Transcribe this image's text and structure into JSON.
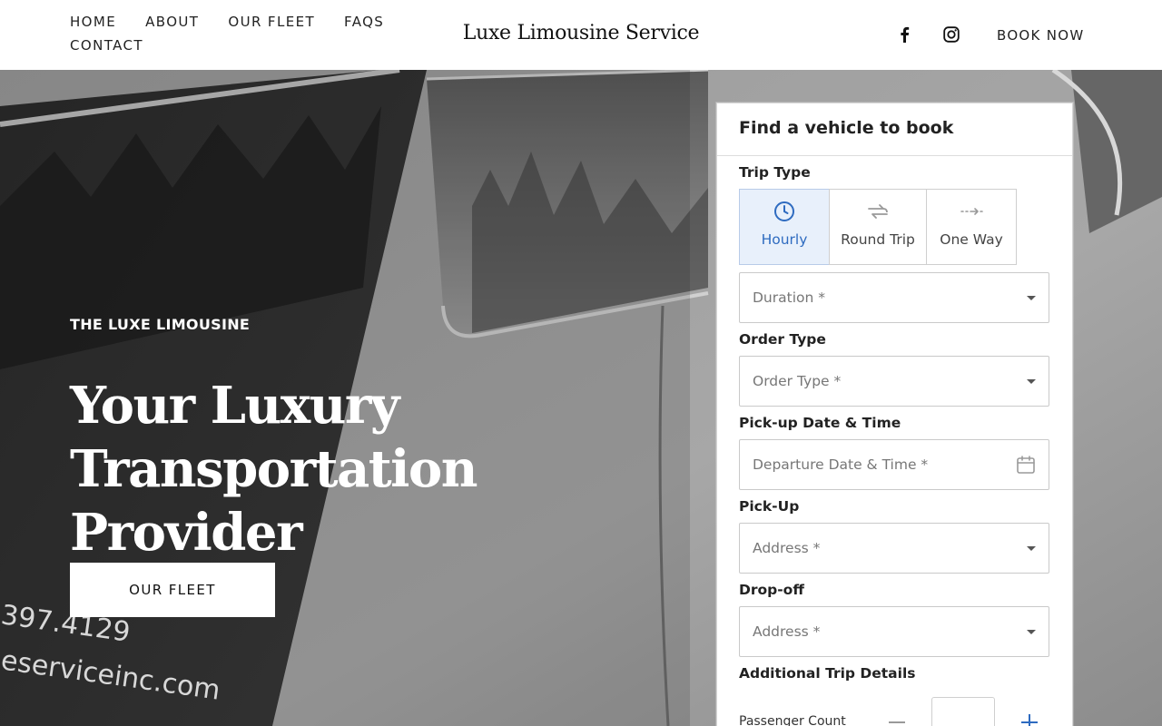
{
  "header": {
    "nav": [
      {
        "label": "HOME"
      },
      {
        "label": "ABOUT"
      },
      {
        "label": "OUR FLEET"
      },
      {
        "label": "FAQS"
      },
      {
        "label": "CONTACT"
      }
    ],
    "logo": "Luxe Limousine Service",
    "social": [
      "facebook-icon",
      "instagram-icon"
    ],
    "book_now": "BOOK NOW"
  },
  "hero": {
    "eyebrow": "THE LUXE LIMOUSINE",
    "headline_line1": "Your Luxury",
    "headline_line2": "Transportation Provider",
    "cta": "OUR FLEET",
    "background": "grayscale photo of a limousine bus side and window",
    "bg_text_1": "397.4129",
    "bg_text_2": "eserviceinc.com"
  },
  "booking": {
    "title": "Find a vehicle to book",
    "trip_type_label": "Trip Type",
    "trip_types": [
      {
        "label": "Hourly",
        "icon": "clock-icon",
        "active": true
      },
      {
        "label": "Round Trip",
        "icon": "round-trip-icon",
        "active": false
      },
      {
        "label": "One Way",
        "icon": "one-way-icon",
        "active": false
      }
    ],
    "duration_placeholder": "Duration *",
    "order_type_label": "Order Type",
    "order_type_placeholder": "Order Type *",
    "pickup_datetime_label": "Pick-up Date & Time",
    "pickup_datetime_placeholder": "Departure Date & Time *",
    "pickup_label": "Pick-Up",
    "pickup_placeholder": "Address *",
    "dropoff_label": "Drop-off",
    "dropoff_placeholder": "Address *",
    "additional_label": "Additional Trip Details",
    "passenger_count_label": "Passenger Count",
    "passenger_count_value": ""
  },
  "colors": {
    "accent_blue": "#2e6bc0",
    "active_bg": "#e8f0fb",
    "text_dark": "#222222"
  }
}
